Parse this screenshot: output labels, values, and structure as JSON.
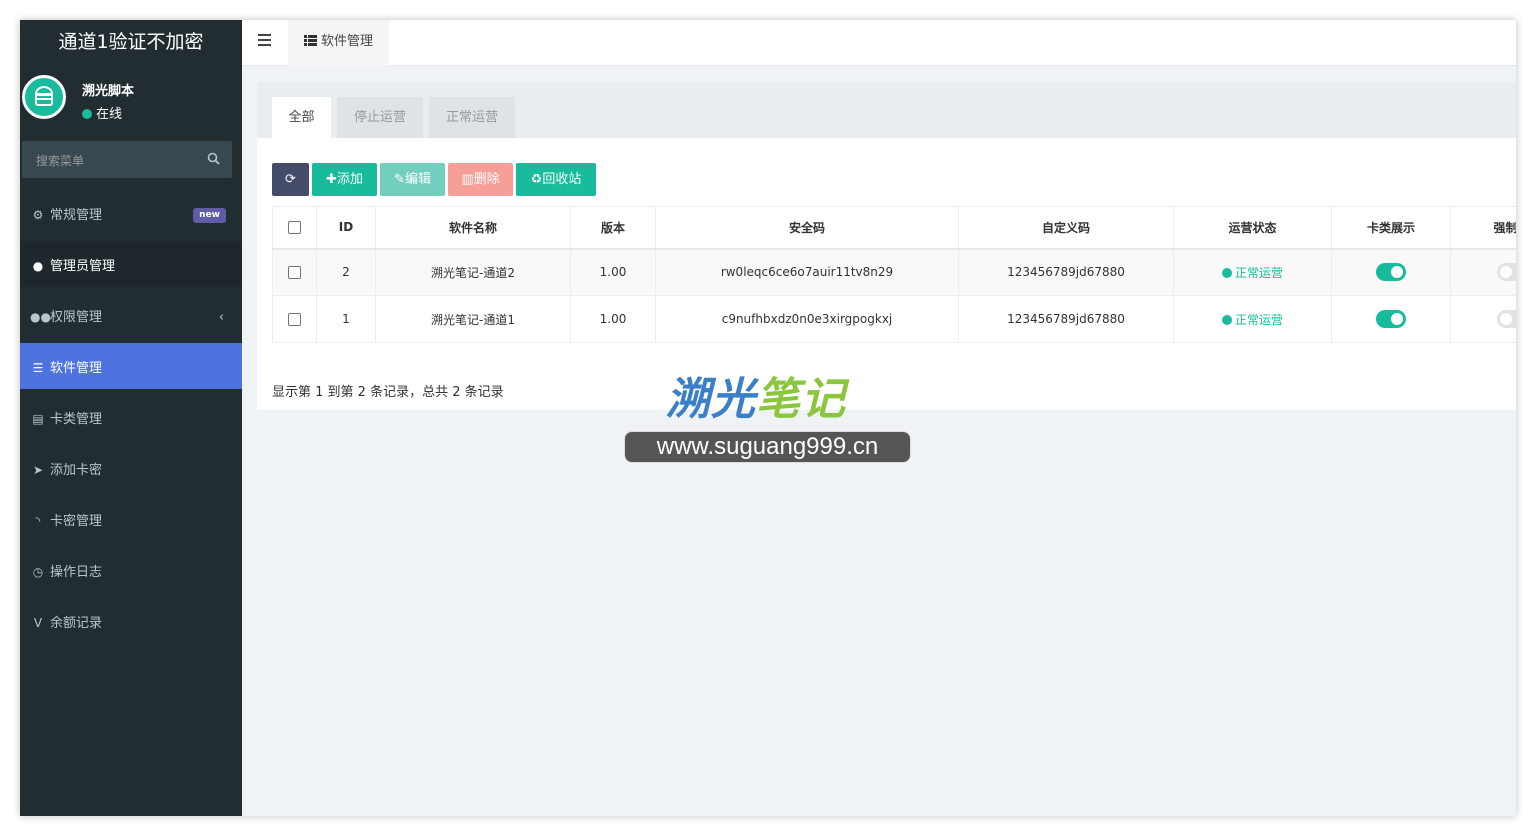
{
  "app": {
    "title": "通道1验证不加密",
    "user": {
      "name": "溯光脚本",
      "status": "在线"
    },
    "search_placeholder": "搜索菜单"
  },
  "menu": [
    {
      "label": "常规管理",
      "icon": "cogs-icon",
      "badge": "new"
    },
    {
      "label": "管理员管理",
      "icon": "user-icon"
    },
    {
      "label": "权限管理",
      "icon": "group-icon",
      "chevron": "‹"
    },
    {
      "label": "软件管理",
      "icon": "list-icon"
    },
    {
      "label": "卡类管理",
      "icon": "card-icon"
    },
    {
      "label": "添加卡密",
      "icon": "paper-plane-icon"
    },
    {
      "label": "卡密管理",
      "icon": "rss-icon"
    },
    {
      "label": "操作日志",
      "icon": "clock-icon"
    },
    {
      "label": "余额记录",
      "icon": "vimeo-icon"
    }
  ],
  "header": {
    "tab_label": "软件管理"
  },
  "filter_tabs": [
    "全部",
    "停止运营",
    "正常运营"
  ],
  "toolbar": {
    "add": "添加",
    "edit": "编辑",
    "delete": "删除",
    "recycle": "回收站"
  },
  "table": {
    "columns": [
      "ID",
      "软件名称",
      "版本",
      "安全码",
      "自定义码",
      "运营状态",
      "卡类展示",
      "强制更"
    ],
    "rows": [
      {
        "id": "2",
        "name": "溯光笔记-通道2",
        "version": "1.00",
        "security_code": "rw0leqc6ce6o7auir11tv8n29",
        "custom_code": "123456789jd67880",
        "status": "正常运营",
        "card_display": true,
        "force_update": false
      },
      {
        "id": "1",
        "name": "溯光笔记-通道1",
        "version": "1.00",
        "security_code": "c9nufhbxdz0n0e3xirgpogkxj",
        "custom_code": "123456789jd67880",
        "status": "正常运营",
        "card_display": true,
        "force_update": false
      }
    ]
  },
  "pagination_text": "显示第 1 到第 2 条记录，总共 2 条记录",
  "watermark": {
    "logo_a": "溯光",
    "logo_b": "笔记",
    "url": "www.suguang999.cn"
  },
  "colors": {
    "accent": "#18bc9c",
    "active_menu": "#4e73df",
    "sidebar": "#222d32"
  }
}
